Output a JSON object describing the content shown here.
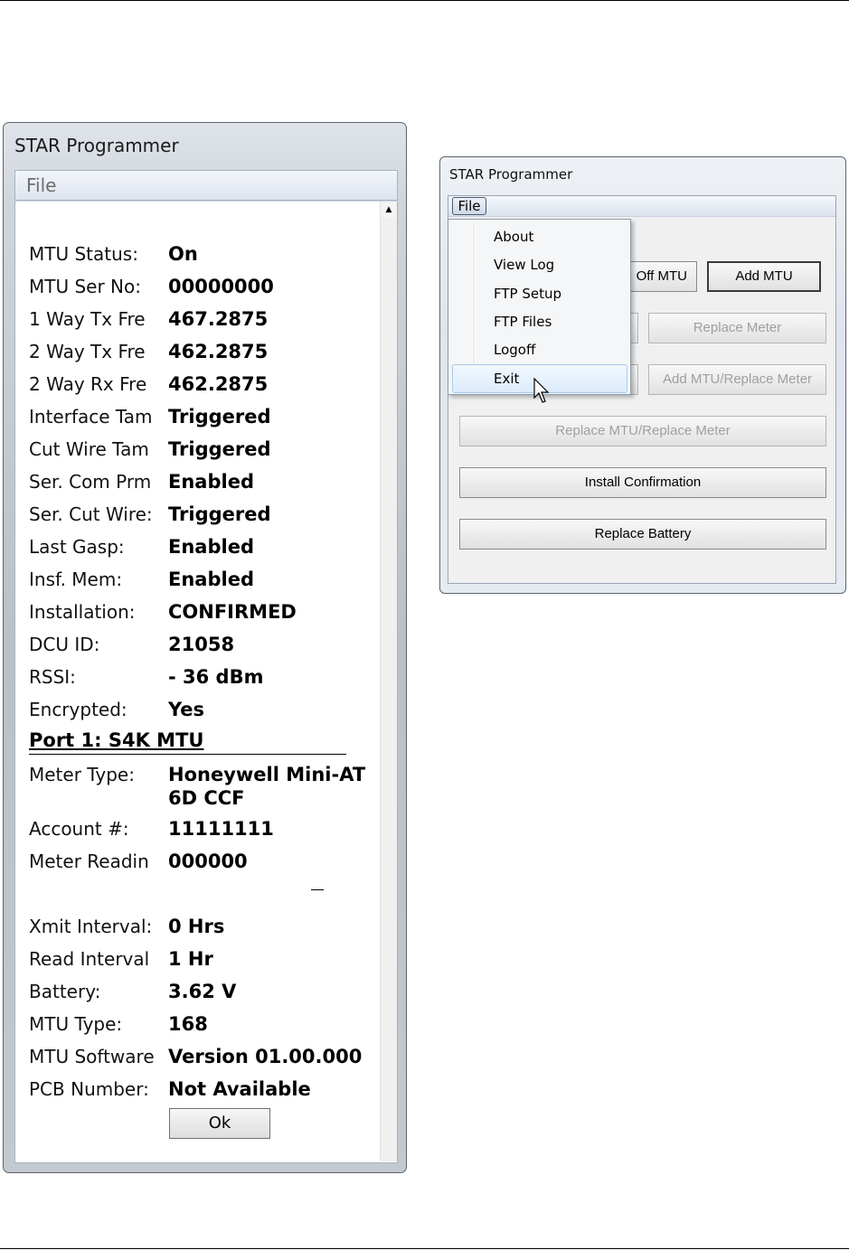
{
  "left_window": {
    "title": "STAR Programmer",
    "menu_file": "File",
    "fields": [
      {
        "label": "MTU Status:",
        "value": "On"
      },
      {
        "label": "MTU Ser No:",
        "value": "00000000"
      },
      {
        "label": "1 Way Tx Fre",
        "value": "467.2875"
      },
      {
        "label": "2 Way Tx Fre",
        "value": "462.2875"
      },
      {
        "label": "2 Way Rx Fre",
        "value": "462.2875"
      },
      {
        "label": "Interface Tam",
        "value": "Triggered"
      },
      {
        "label": "Cut Wire Tam",
        "value": "Triggered"
      },
      {
        "label": "Ser. Com Prm",
        "value": "Enabled"
      },
      {
        "label": "Ser. Cut Wire:",
        "value": "Triggered"
      },
      {
        "label": "Last Gasp:",
        "value": "Enabled"
      },
      {
        "label": "Insf. Mem:",
        "value": "Enabled"
      },
      {
        "label": "Installation:",
        "value": "CONFIRMED"
      },
      {
        "label": "DCU ID:",
        "value": "21058"
      },
      {
        "label": "RSSI:",
        "value": "- 36 dBm"
      },
      {
        "label": "Encrypted:",
        "value": "Yes"
      }
    ],
    "port_header": "Port 1: S4K MTU",
    "port_fields": [
      {
        "label": "Meter Type:",
        "value": "Honeywell Mini-AT",
        "value2": "6D CCF"
      },
      {
        "label": "Account #:",
        "value": "11111111"
      },
      {
        "label": "Meter Readin",
        "value": "000000"
      }
    ],
    "interval_fields": [
      {
        "label": "Xmit Interval:",
        "value": "0 Hrs"
      },
      {
        "label": "Read Interval",
        "value": "1 Hr"
      },
      {
        "label": "Battery:",
        "value": "3.62 V"
      },
      {
        "label": "MTU Type:",
        "value": "168"
      },
      {
        "label": "MTU Software",
        "value": "Version 01.00.000"
      },
      {
        "label": "PCB Number:",
        "value": "Not Available"
      }
    ],
    "ok_label": "Ok"
  },
  "right_window": {
    "title": "STAR Programmer",
    "menu_file": "File",
    "buttons": {
      "off_mtu": "Off MTU",
      "add_mtu": "Add MTU",
      "replace_meter": "Replace Meter",
      "add_mtu_replace_meter": "Add MTU/Replace Meter",
      "replace_mtu_replace_meter": "Replace MTU/Replace Meter",
      "install_confirmation": "Install Confirmation",
      "replace_battery": "Replace Battery"
    },
    "file_menu": [
      "About",
      "View Log",
      "FTP Setup",
      "FTP Files",
      "Logoff",
      "Exit"
    ],
    "highlighted_item": "Exit"
  }
}
